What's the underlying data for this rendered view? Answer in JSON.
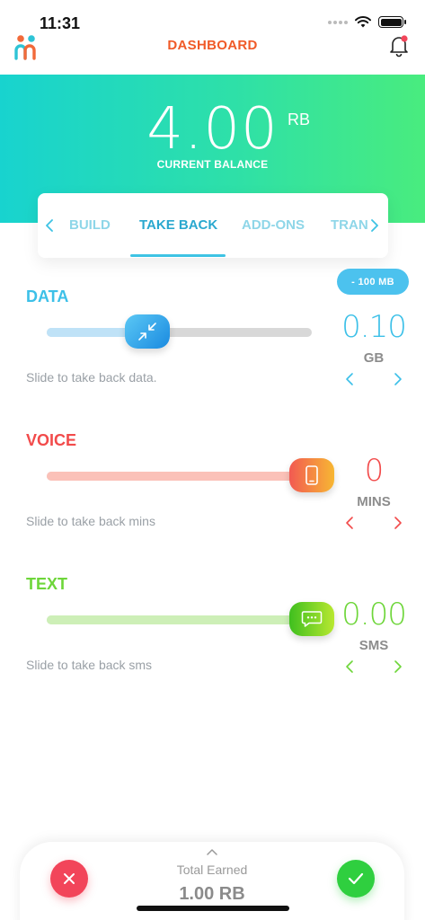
{
  "status_bar": {
    "time": "11:31"
  },
  "header": {
    "title": "DASHBOARD"
  },
  "balance": {
    "value": "4.00",
    "unit": "RB",
    "label": "CURRENT BALANCE"
  },
  "tabs": [
    {
      "label": "BUILD",
      "active": false
    },
    {
      "label": "TAKE BACK",
      "active": true
    },
    {
      "label": "ADD-ONS",
      "active": false
    },
    {
      "label": "TRAN",
      "active": false
    }
  ],
  "sections": {
    "data": {
      "title": "DATA",
      "chip": "- 100  MB",
      "amount": "0.10",
      "unit": "GB",
      "hint": "Slide to take back data.",
      "slider_fraction": 0.38,
      "accent": "#3cc0e8"
    },
    "voice": {
      "title": "VOICE",
      "amount": "0",
      "unit": "MINS",
      "hint": "Slide to take back mins",
      "slider_fraction": 1.0,
      "accent": "#f24b4b"
    },
    "text": {
      "title": "TEXT",
      "amount": "0.00",
      "unit": "SMS",
      "hint": "Slide to take back sms",
      "slider_fraction": 1.0,
      "accent": "#6ed63a"
    }
  },
  "bottom": {
    "label": "Total Earned",
    "value": "1.00 RB"
  },
  "colors": {
    "brand_orange": "#f05a28",
    "hero_start": "#18d3cf",
    "hero_end": "#49ec7e",
    "cancel": "#f2455a",
    "confirm": "#2fcf3f"
  }
}
